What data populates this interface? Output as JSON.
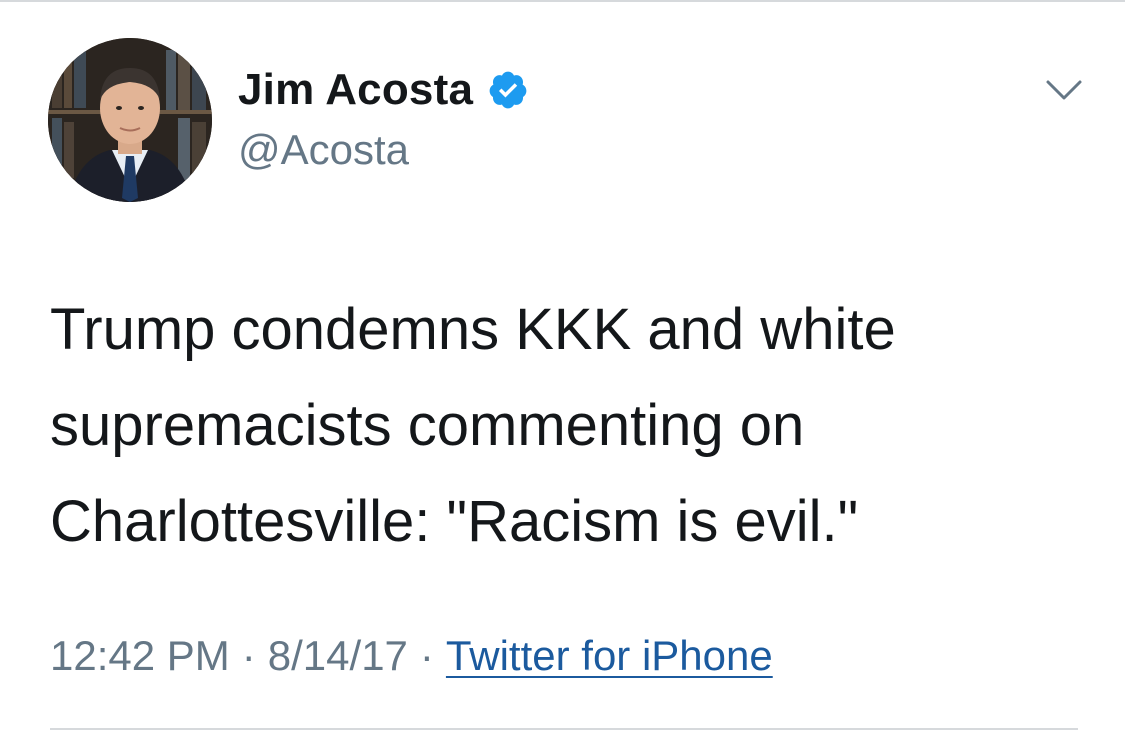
{
  "author": {
    "display_name": "Jim Acosta",
    "handle": "@Acosta",
    "verified_icon": "verified-badge-icon",
    "avatar_icon": "profile-avatar"
  },
  "tweet": {
    "text": "Trump condemns KKK and white supremacists commenting on Charlottesville: \"Racism is evil.\"",
    "time": "12:42 PM",
    "separator": "·",
    "date": "8/14/17",
    "source": "Twitter for iPhone"
  },
  "controls": {
    "more_icon": "chevron-down-icon"
  },
  "colors": {
    "text_primary": "#14171a",
    "text_secondary": "#657786",
    "link": "#1b5a9e",
    "verified": "#1d9bf0",
    "divider": "#d6d9dc"
  }
}
